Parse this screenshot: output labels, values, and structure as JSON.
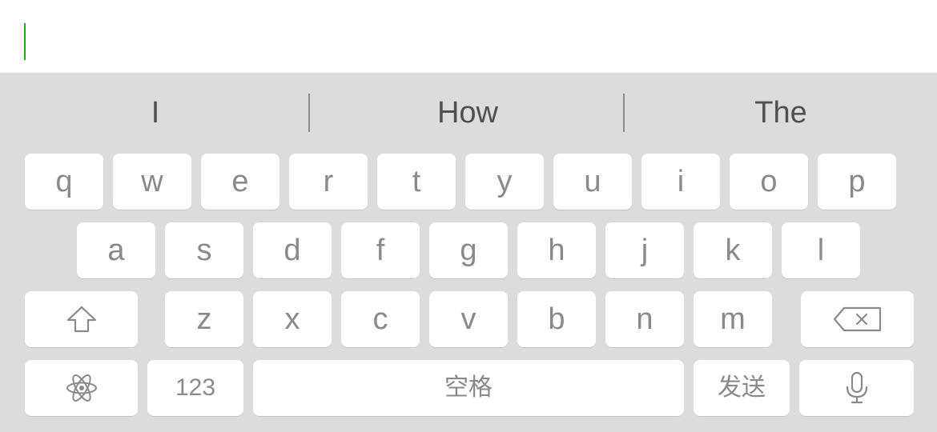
{
  "input": {
    "value": ""
  },
  "suggestions": [
    "I",
    "How",
    "The"
  ],
  "keys": {
    "row1": [
      "q",
      "w",
      "e",
      "r",
      "t",
      "y",
      "u",
      "i",
      "o",
      "p"
    ],
    "row2": [
      "a",
      "s",
      "d",
      "f",
      "g",
      "h",
      "j",
      "k",
      "l"
    ],
    "row3": [
      "z",
      "x",
      "c",
      "v",
      "b",
      "n",
      "m"
    ],
    "numbers_label": "123",
    "space_label": "空格",
    "send_label": "发送"
  },
  "icons": {
    "shift": "shift-arrow-icon",
    "delete": "backspace-icon",
    "emoji": "atom-icon",
    "voice": "microphone-icon"
  },
  "colors": {
    "keyboard_bg": "#dcdcdc",
    "key_bg": "#ffffff",
    "key_text": "#8a8a8a",
    "cursor": "#1aad19"
  }
}
